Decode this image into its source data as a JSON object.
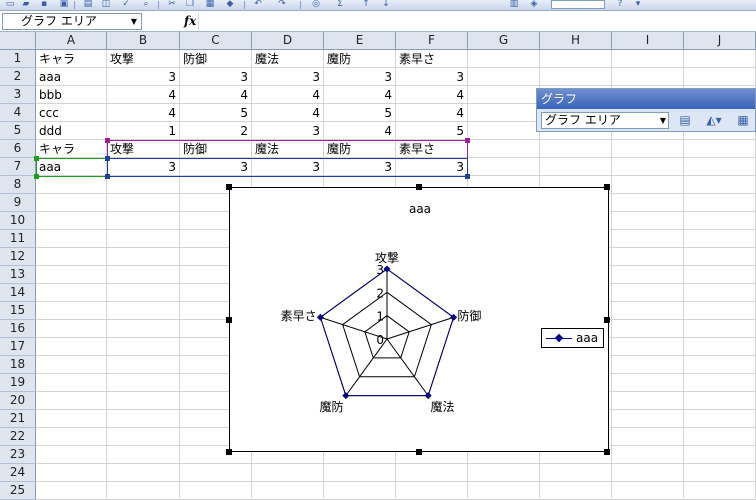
{
  "formula_bar": {
    "name_box": "グラフ エリア",
    "fx": "fx"
  },
  "columns": [
    "A",
    "B",
    "C",
    "D",
    "E",
    "F",
    "G",
    "H",
    "I",
    "J"
  ],
  "rows": [
    "1",
    "2",
    "3",
    "4",
    "5",
    "6",
    "7",
    "8",
    "9",
    "10",
    "11",
    "12",
    "13",
    "14",
    "15",
    "16",
    "17",
    "18",
    "19",
    "20",
    "21",
    "22",
    "23",
    "24",
    "25"
  ],
  "cells": [
    [
      "キャラ",
      "攻撃",
      "防御",
      "魔法",
      "魔防",
      "素早さ"
    ],
    [
      "aaa",
      "3",
      "3",
      "3",
      "3",
      "3"
    ],
    [
      "bbb",
      "4",
      "4",
      "4",
      "4",
      "4"
    ],
    [
      "ccc",
      "4",
      "5",
      "4",
      "5",
      "4"
    ],
    [
      "ddd",
      "1",
      "2",
      "3",
      "4",
      "5"
    ],
    [
      "キャラ",
      "攻撃",
      "防御",
      "魔法",
      "魔防",
      "素早さ"
    ],
    [
      "aaa",
      "3",
      "3",
      "3",
      "3",
      "3"
    ]
  ],
  "chart_toolbar": {
    "title": "グラフ",
    "selected_object": "グラフ エリア"
  },
  "chart_data": {
    "type": "radar",
    "title": "aaa",
    "categories": [
      "攻撃",
      "防御",
      "魔法",
      "魔防",
      "素早さ"
    ],
    "axis_ticks": [
      "0",
      "1",
      "2",
      "3"
    ],
    "rmax": 3,
    "series": [
      {
        "name": "aaa",
        "values": [
          3,
          3,
          3,
          3,
          3
        ],
        "color": "#00007f"
      }
    ],
    "grid": true,
    "legend": "right"
  }
}
